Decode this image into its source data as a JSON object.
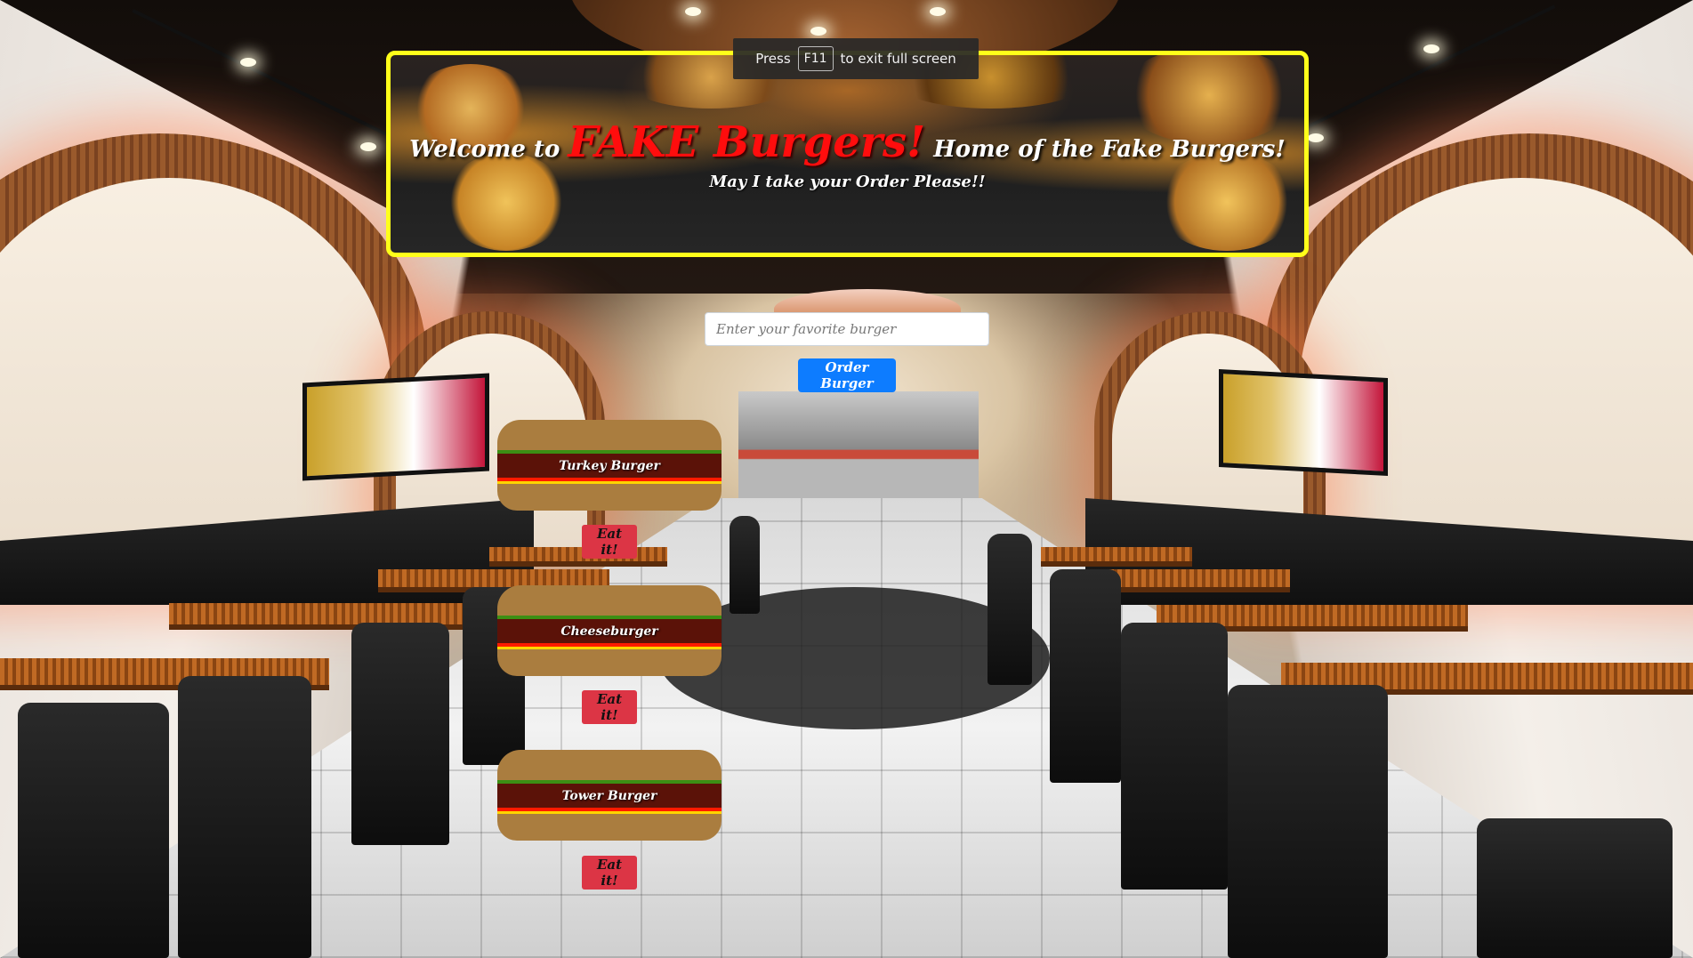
{
  "fullscreen_notice": {
    "prefix": "Press",
    "key": "F11",
    "suffix": "to exit full screen"
  },
  "banner": {
    "welcome": "Welcome to",
    "brand": "FAKE Burgers!",
    "tagline": "Home of the Fake Burgers!",
    "subtitle": "May I take your Order Please!!"
  },
  "order_form": {
    "placeholder": "Enter your favorite burger",
    "value": "",
    "button_label": "Order Burger"
  },
  "burgers": [
    {
      "name": "Turkey Burger",
      "action_label": "Eat it!"
    },
    {
      "name": "Cheeseburger",
      "action_label": "Eat it!"
    },
    {
      "name": "Tower Burger",
      "action_label": "Eat it!"
    }
  ],
  "colors": {
    "banner_border": "#ffff1a",
    "brand_red": "#ff0d0d",
    "order_button": "#0d7cff",
    "eat_button": "#dc3545",
    "bun": "#aa7d3f",
    "patty": "#5b1208",
    "lettuce": "#3c8f14",
    "ketchup": "#ff1a00",
    "mustard": "#ffd400"
  }
}
